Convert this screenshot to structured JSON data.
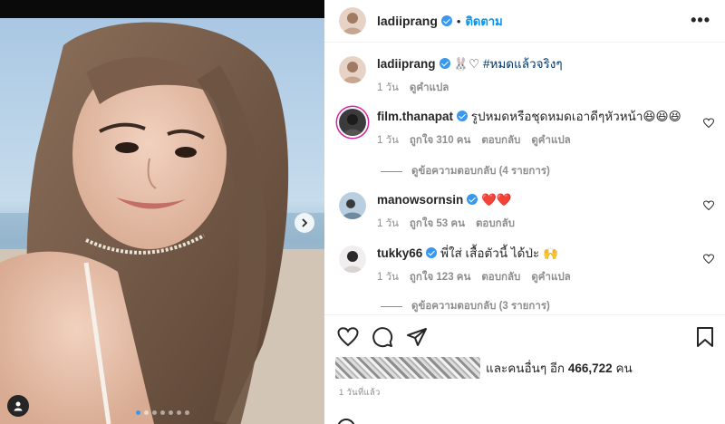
{
  "post": {
    "username": "ladiiprang",
    "follow_label": "ติดตาม",
    "separator": "•",
    "more_label": "•••",
    "slides_total": 7,
    "slides_active": 1
  },
  "caption": {
    "username": "ladiiprang",
    "emoji": "🐰♡",
    "hashtag": "#หมดแล้วจริงๆ",
    "time": "1 วัน",
    "translate": "ดูคำแปล"
  },
  "comments": [
    {
      "username": "film.thanapat",
      "text": "รูปหมดหรือชุดหมดเอาดีๆหัวหน้า😆😆😆",
      "time": "1 วัน",
      "likes": "ถูกใจ 310 คน",
      "reply": "ตอบกลับ",
      "translate": "ดูคำแปล",
      "view_replies": "ดูข้อความตอบกลับ (4 รายการ)"
    },
    {
      "username": "manowsornsin",
      "text": "❤️❤️",
      "time": "1 วัน",
      "likes": "ถูกใจ 53 คน",
      "reply": "ตอบกลับ"
    },
    {
      "username": "tukky66",
      "text": "พี่ใส่ เสื้อตัวนี้ ได้ป่ะ 🙌",
      "time": "1 วัน",
      "likes": "ถูกใจ 123 คน",
      "reply": "ตอบกลับ",
      "translate": "ดูคำแปล",
      "view_replies": "ดูข้อความตอบกลับ (3 รายการ)"
    }
  ],
  "likes_summary": {
    "prefix": "และคนอื่นๆ อีก",
    "count": "466,722",
    "suffix": "คน"
  },
  "posted_ago": "1 วันที่แล้ว",
  "colors": {
    "accent": "#0095f6",
    "verified": "#3897f0",
    "muted": "#8e8e8e",
    "text": "#262626",
    "heart_red": "#e0245e"
  }
}
